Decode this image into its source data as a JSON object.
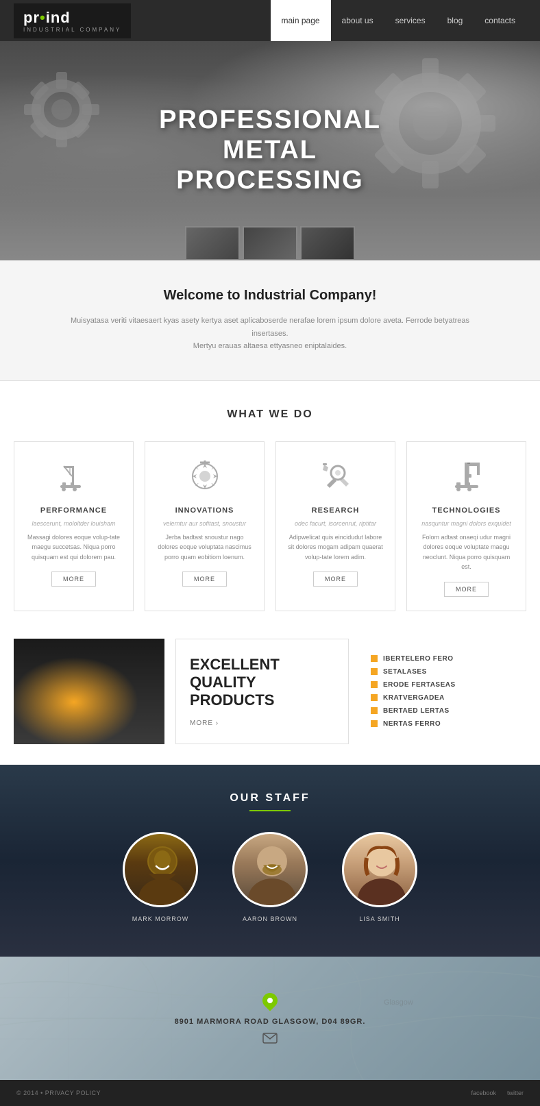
{
  "nav": {
    "links": [
      {
        "label": "main page",
        "active": true
      },
      {
        "label": "about us",
        "active": false
      },
      {
        "label": "services",
        "active": false
      },
      {
        "label": "blog",
        "active": false
      },
      {
        "label": "contacts",
        "active": false
      }
    ]
  },
  "logo": {
    "name": "pr•ind",
    "subtitle": "INDUSTRIAL COMPANY"
  },
  "hero": {
    "title": "PROFESSIONAL\nMETAL\nPROCESSING"
  },
  "welcome": {
    "heading": "Welcome to Industrial Company!",
    "body1": "Muisyatasa veriti vitaesaert kyas asety kertya aset aplicaboserde nerafae lorem ipsum dolore aveta. Ferrode betyatreas",
    "body2": "insertases.",
    "body3": "Mertyu erauas altaesa ettyasneo eniptalaides."
  },
  "what_we_do": {
    "title": "WHAT WE DO",
    "services": [
      {
        "title": "PERFORMANCE",
        "subtitle": "laescerunt, mololtder louisham",
        "desc": "Massagi dolores eoque volup-tate maegu succetsas. Niqua porro quisquam est qui dolorem pau.",
        "btn": "MORE"
      },
      {
        "title": "INNOVATIONS",
        "subtitle": "velerntur aur sofitast, snoustur",
        "desc": "Jerba badtast snoustur nago dolores eoque voluptata nascimus porro quam eobitiom loenum.",
        "btn": "MORE"
      },
      {
        "title": "RESEARCH",
        "subtitle": "odec facurt, isorcenrut, riptitar",
        "desc": "Adipwelicat quis eincidudut labore sit dolores mogam adipam quaerat volup-tate lorem adim.",
        "btn": "MORE"
      },
      {
        "title": "TECHNOLOGIES",
        "subtitle": "nasquntur magni dolors exquidet",
        "desc": "Folom adtast onaeqi udur magni dolores eoque voluptate maegu neoclunt. Niqua porro quisquam est.",
        "btn": "MORE"
      }
    ]
  },
  "quality": {
    "heading": "EXCELLENT\nQUALITY\nPRODUCTS",
    "more": "MORE ›",
    "list": [
      "IBERTELERO FERO",
      "SETALASES",
      "ERODE FERTASEAS",
      "KRATVERGADEA",
      "BERTAED LERTAS",
      "NERTAS FERRO"
    ]
  },
  "staff": {
    "title": "OUR STAFF",
    "members": [
      {
        "name": "MARK MORROW"
      },
      {
        "name": "AARON BROWN"
      },
      {
        "name": "LISA SMITH"
      }
    ]
  },
  "map": {
    "address": "8901 MARMORA ROAD GLASGOW, D04 89GR."
  },
  "footer": {
    "copy": "© 2014 • PRIVACY POLICY",
    "links": [
      "facebook",
      "twitter"
    ]
  }
}
